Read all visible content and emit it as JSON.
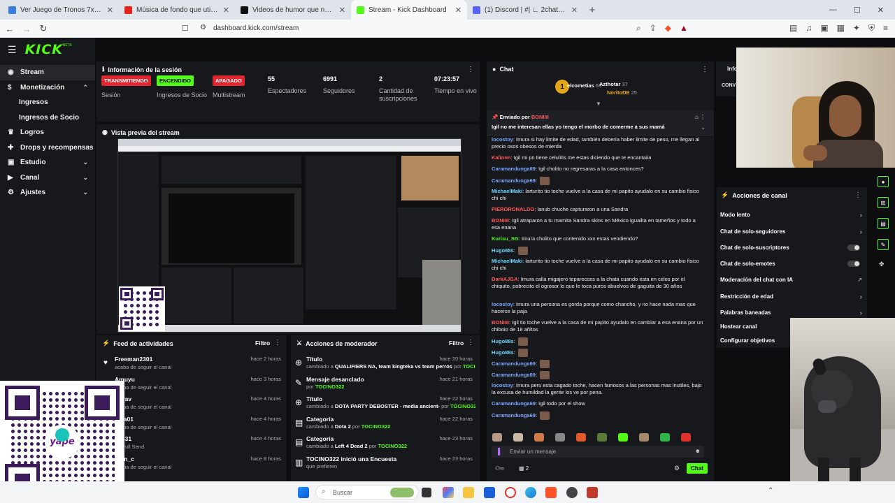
{
  "browser": {
    "tabs": [
      {
        "label": "Ver Juego de Tronos 7x3 Online Gra…",
        "color": "#3b7ddd",
        "active": false
      },
      {
        "label": "Música de fondo que utiliza Spreen",
        "color": "#e62117",
        "active": false
      },
      {
        "label": "Videos de humor que no toleran la fr…",
        "color": "#111111",
        "active": false
      },
      {
        "label": "Stream - Kick Dashboard",
        "color": "#53fc18",
        "active": true
      },
      {
        "label": "(1) Discord | #| ∟ 2chat-general | TC…",
        "color": "#5865f2",
        "active": false
      }
    ],
    "new_tab": "+",
    "url": "dashboard.kick.com/stream"
  },
  "app": {
    "logo": "KICK",
    "logo_sup": "BETA",
    "accent": "#53fc18",
    "nav": [
      {
        "label": "Stream",
        "icon": "broadcast-icon",
        "active": true,
        "chevron": false
      },
      {
        "label": "Monetización",
        "icon": "dollar-icon",
        "active": false,
        "chevron": true
      },
      {
        "label": "Ingresos",
        "sub": true
      },
      {
        "label": "Ingresos de Socio",
        "sub": true
      },
      {
        "label": "Logros",
        "icon": "trophy-icon",
        "chevron": false
      },
      {
        "label": "Drops y recompensas",
        "icon": "gift-icon",
        "chevron": false
      },
      {
        "label": "Estudio",
        "icon": "studio-icon",
        "chevron": true
      },
      {
        "label": "Canal",
        "icon": "channel-icon",
        "chevron": true
      },
      {
        "label": "Ajustes",
        "icon": "gear-icon",
        "chevron": true
      }
    ]
  },
  "session": {
    "title": "Información de la sesión",
    "stats": [
      {
        "badge": "TRANSMITIENDO",
        "badge_color": "#e0262e",
        "label": "Sesión"
      },
      {
        "badge": "ENCENDIDO",
        "badge_color": "#53fc18",
        "label": "Ingresos de Socio"
      },
      {
        "badge": "APAGADO",
        "badge_color": "#e0262e",
        "label": "Multistream"
      },
      {
        "value": "55",
        "label": "Espectadores"
      },
      {
        "value": "6991",
        "label": "Seguidores"
      },
      {
        "value": "2",
        "label": "Cantidad de suscripciones"
      },
      {
        "value": "07:23:57",
        "label": "Tiempo en vivo"
      }
    ]
  },
  "preview": {
    "title": "Vista previa del stream"
  },
  "feed": {
    "title": "Feed de actividades",
    "filter": "Filtro",
    "items": [
      {
        "name": "Freeman2301",
        "sub": "acaba de seguir el canal",
        "time": "hace 2 horas"
      },
      {
        "name": "Amuyu",
        "sub": "acaba de seguir el canal",
        "time": "hace 3 horas"
      },
      {
        "name": "rrerav",
        "sub": "acaba de seguir el canal",
        "time": "hace 4 horas"
      },
      {
        "name": "anta01",
        "sub": "acaba de seguir el canal",
        "time": "hace 4 horas"
      },
      {
        "name": "u5431",
        "sub": "un Full Send",
        "time": "hace 4 horas"
      },
      {
        "name": "rson_c",
        "sub": "acaba de seguir el canal",
        "time": "hace 8 horas"
      }
    ]
  },
  "modactions": {
    "title": "Acciones de moderador",
    "filter": "Filtro",
    "items": [
      {
        "icon": "title-icon",
        "name": "Título",
        "pre": "cambiado a ",
        "bold": "QUALIFIERS NA, team kingteka vs team perros",
        "mid": " por ",
        "user": "TOCINO322",
        "time": "hace 20 horas"
      },
      {
        "icon": "unpin-icon",
        "name": "Mensaje desanclado",
        "pre": "por ",
        "bold": "",
        "mid": "",
        "user": "TOCINO322",
        "time": "hace 21 horas"
      },
      {
        "icon": "title-icon",
        "name": "Título",
        "pre": "cambiado a ",
        "bold": "DOTA PARTY DEBOSTER - media ancient-",
        "mid": " por ",
        "user": "TOCINO322",
        "time": "hace 22 horas"
      },
      {
        "icon": "category-icon",
        "name": "Categoría",
        "pre": "cambiado a ",
        "bold": "Dota 2",
        "mid": " por ",
        "user": "TOCINO322",
        "time": "hace 22 horas"
      },
      {
        "icon": "category-icon",
        "name": "Categoría",
        "pre": "cambiado a ",
        "bold": "Left 4 Dead 2",
        "mid": " por ",
        "user": "TOCINO322",
        "time": "hace 23 horas"
      },
      {
        "icon": "poll-icon",
        "name": "TOCINO322 inició una Encuesta",
        "pre": "que prefieren",
        "bold": "",
        "mid": "",
        "user": "",
        "time": "hace 23 horas"
      }
    ]
  },
  "chat": {
    "title": "Chat",
    "top_users": [
      {
        "name": "elcometias",
        "count": "63"
      },
      {
        "name": "Azthotar",
        "count": "37"
      },
      {
        "name": "NorltoDE",
        "count": "25"
      }
    ],
    "pinned_by_label": "Enviado por",
    "pinned_user": "BONIIII",
    "pinned_text": "Igil no me interesan ellas yo tengo el morbo de comerme a sus mamá",
    "messages": [
      {
        "user": "locostoy",
        "color": "#7aa7ff",
        "text": "Imura si hay limite de edad, también debería haber limite de peso, me llegan al precio osos obesos de mierda"
      },
      {
        "user": "Kalinnn",
        "color": "#ff5a5a",
        "text": "Igil mi pn tiene celulitis me estas diciendo que te encantaiia"
      },
      {
        "user": "Caramandunga69",
        "color": "#7aa7ff",
        "text": "Igil cholito no regresaras a la casa entonces?"
      },
      {
        "user": "Caramandunga69",
        "color": "#7aa7ff",
        "text": "",
        "emote": true
      },
      {
        "user": "MichaelMaki",
        "color": "#6fd7ff",
        "text": "larturito tio toche vuelve a la casa de mi papito ayudalo en su cambio fisico chi chi"
      },
      {
        "user": "PIERORONALDO",
        "color": "#ff5a5a",
        "text": "lanub chuche capturaron a una Sandra"
      },
      {
        "user": "BONIIII",
        "color": "#ff5a5a",
        "text": "Igil atraparon a tu mamita Sandra skins en México iguailta en tameños y todo a esa enana"
      },
      {
        "user": "Kurisu_SG",
        "color": "#53fc18",
        "text": "Imura cholito que contenido xxx estas vendiendo?"
      },
      {
        "user": "Hugo88s",
        "color": "#6fd7ff",
        "text": "",
        "emote": true
      },
      {
        "user": "MichaelMaki",
        "color": "#6fd7ff",
        "text": "larturito tio toche vuelve a la casa de mi papito ayudalo en su cambio fisico chi chi"
      },
      {
        "user": "DarkAJGA",
        "color": "#ff5a5a",
        "text": "Imura calla migajero teparecces a la chata cuando esta en celos por el chiquito, pobrecito el ogrosor lo que le toca puros abuelvos de gaguita de 30 años"
      },
      {
        "user": "locostoy",
        "color": "#7aa7ff",
        "text": "Imura una persona es gorda porque como chancho, y no hace nada mas que hacerce la paja"
      },
      {
        "user": "BONIIII",
        "color": "#ff5a5a",
        "text": "Igil tio toche vuelve a la casa de mi papito ayudalo en cambiar a esa enana por un chiboio de 18 añitos"
      },
      {
        "user": "Hugo88s",
        "color": "#6fd7ff",
        "text": "",
        "emote": true
      },
      {
        "user": "Hugo88s",
        "color": "#6fd7ff",
        "text": "",
        "emote": true
      },
      {
        "user": "Caramandunga69",
        "color": "#7aa7ff",
        "text": "",
        "emote": true
      },
      {
        "user": "Caramandunga69",
        "color": "#7aa7ff",
        "text": "",
        "emote": true
      },
      {
        "user": "locostoy",
        "color": "#7aa7ff",
        "text": "Imura peru esta cagado toche, hacen famosos a las personas mas inutiles, bajo la excusa de humildad la gente los ve por pena."
      },
      {
        "user": "Caramandunga69",
        "color": "#7aa7ff",
        "text": "Igil todo por el show"
      },
      {
        "user": "Caramandunga69",
        "color": "#7aa7ff",
        "text": "",
        "emote": true
      }
    ],
    "input_placeholder": "Enviar un mensaje",
    "viewer_count": "2",
    "send_label": "Chat"
  },
  "channel_actions": {
    "title": "Acciones de canal",
    "items": [
      {
        "label": "Modo lento",
        "kind": "chevron"
      },
      {
        "label": "Chat de solo-seguidores",
        "kind": "chevron"
      },
      {
        "label": "Chat de solo-suscriptores",
        "kind": "toggle"
      },
      {
        "label": "Chat de solo-emotes",
        "kind": "toggle"
      },
      {
        "label": "Moderación del chat con IA",
        "kind": "link"
      },
      {
        "label": "Restricción de edad",
        "kind": "chevron"
      },
      {
        "label": "Palabras baneadas",
        "kind": "chevron"
      },
      {
        "label": "Hostear canal",
        "kind": "none"
      },
      {
        "label": "Configurar objetivos",
        "kind": "none"
      }
    ]
  },
  "info_panel": {
    "title": "Info",
    "snippet": "CONV"
  },
  "taskbar": {
    "search_placeholder": "Buscar"
  }
}
